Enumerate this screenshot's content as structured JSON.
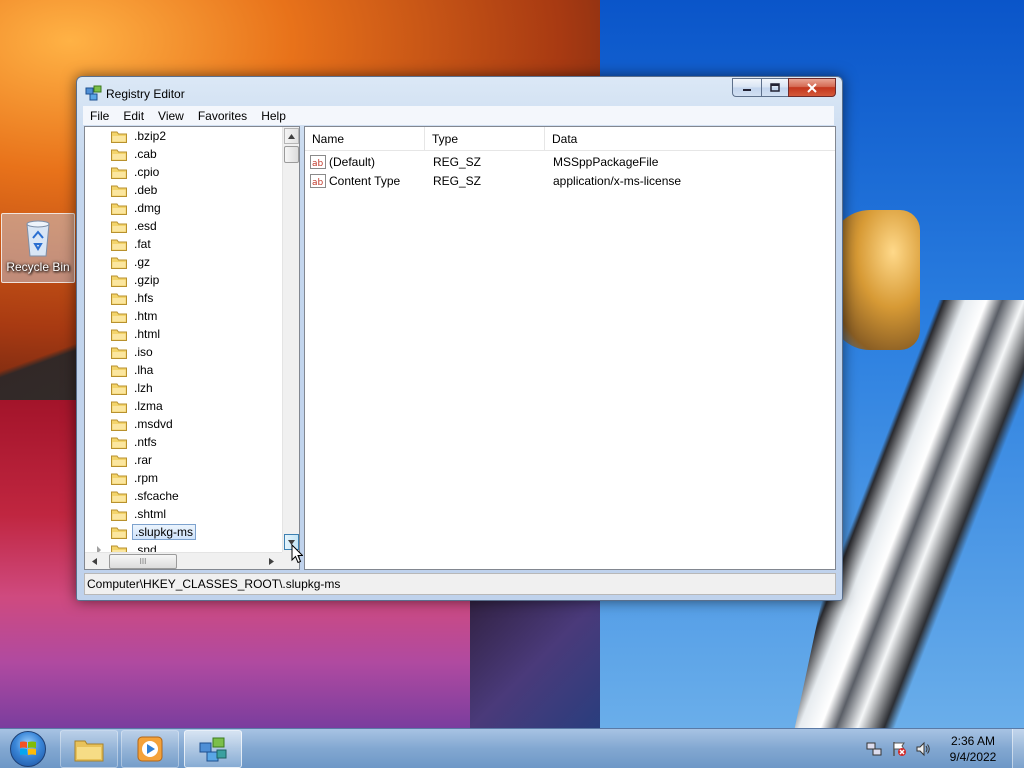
{
  "desktop": {
    "recycle_bin_label": "Recycle Bin"
  },
  "window": {
    "title": "Registry Editor",
    "menu": [
      "File",
      "Edit",
      "View",
      "Favorites",
      "Help"
    ],
    "tree_items": [
      ".bzip2",
      ".cab",
      ".cpio",
      ".deb",
      ".dmg",
      ".esd",
      ".fat",
      ".gz",
      ".gzip",
      ".hfs",
      ".htm",
      ".html",
      ".iso",
      ".lha",
      ".lzh",
      ".lzma",
      ".msdvd",
      ".ntfs",
      ".rar",
      ".rpm",
      ".sfcache",
      ".shtml",
      ".slupkg-ms",
      ".snd"
    ],
    "selected_tree_item": ".slupkg-ms",
    "columns": [
      "Name",
      "Type",
      "Data"
    ],
    "values": [
      {
        "name": "(Default)",
        "type": "REG_SZ",
        "data": "MSSppPackageFile"
      },
      {
        "name": "Content Type",
        "type": "REG_SZ",
        "data": "application/x-ms-license"
      }
    ],
    "status_path": "Computer\\HKEY_CLASSES_ROOT\\.slupkg-ms",
    "hscroll_grip": "III"
  },
  "taskbar": {
    "time": "2:36 AM",
    "date": "9/4/2022"
  },
  "colors": {
    "selection_border": "#7da2ce",
    "close_button": "#c3361d",
    "folder_yellow": "#f3d46b"
  }
}
